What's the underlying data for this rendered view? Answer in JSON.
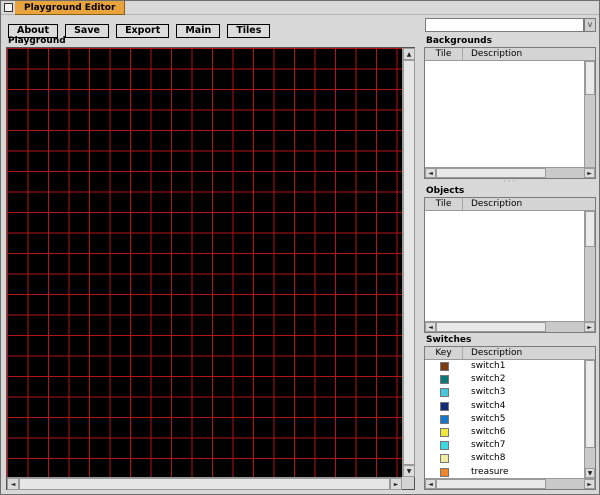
{
  "window": {
    "title": "Playground Editor",
    "title_tab_color": "#e8a33c"
  },
  "toolbar": {
    "buttons": [
      {
        "label": "About"
      },
      {
        "label": "Save"
      },
      {
        "label": "Export"
      },
      {
        "label": "Main"
      },
      {
        "label": "Tiles"
      }
    ]
  },
  "tile_picker": {
    "value": "",
    "dropdown_glyph": "v"
  },
  "playground": {
    "label": "Playground",
    "grid": {
      "cell_size": 20.5,
      "line_color": "#b41414",
      "background": "#000000",
      "columns": 19,
      "rows": 21
    }
  },
  "icons": {
    "up_arrow": "▲",
    "down_arrow": "▼",
    "left_arrow": "◄",
    "right_arrow": "►",
    "splitter_dots": "···"
  },
  "panels": {
    "backgrounds": {
      "label": "Backgrounds",
      "columns": [
        "Tile",
        "Description"
      ],
      "rows": []
    },
    "objects": {
      "label": "Objects",
      "columns": [
        "Tile",
        "Description"
      ],
      "rows": []
    },
    "switches": {
      "label": "Switches",
      "columns": [
        "Key",
        "Description"
      ],
      "rows": [
        {
          "key_color": "#7a3c10",
          "description": "switch1"
        },
        {
          "key_color": "#0e7878",
          "description": "switch2"
        },
        {
          "key_color": "#46c8dc",
          "description": "switch3"
        },
        {
          "key_color": "#142a78",
          "description": "switch4"
        },
        {
          "key_color": "#1874c8",
          "description": "switch5"
        },
        {
          "key_color": "#f0e83c",
          "description": "switch6"
        },
        {
          "key_color": "#3cd8e6",
          "description": "switch7"
        },
        {
          "key_color": "#f0eca0",
          "description": "switch8"
        },
        {
          "key_color": "#f08428",
          "description": "treasure"
        }
      ]
    }
  }
}
